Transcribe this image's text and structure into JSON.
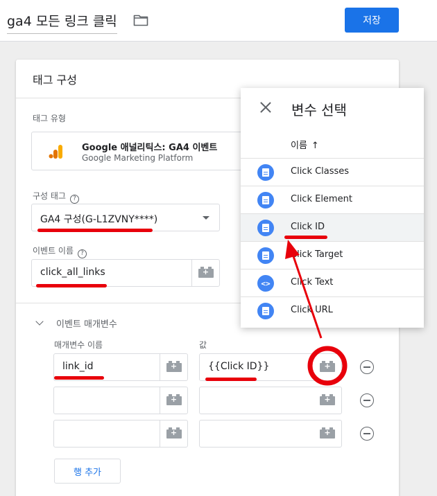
{
  "header": {
    "title": "ga4 모든 링크 클릭",
    "save_label": "저장"
  },
  "card": {
    "title": "태그 구성",
    "tag_type_label": "태그 유형",
    "tag_type_name": "Google 애널리틱스: GA4 이벤트",
    "tag_type_sub": "Google Marketing Platform",
    "config_tag_label": "구성 태그",
    "config_tag_value": "GA4 구성(G-L1ZVNY****)",
    "event_name_label": "이벤트 이름",
    "event_name_value": "click_all_links",
    "params_section_title": "이벤트 매개변수",
    "param_name_header": "매개변수 이름",
    "value_header": "값",
    "rows": [
      {
        "name": "link_id",
        "value": "{{Click ID}}"
      },
      {
        "name": "",
        "value": ""
      },
      {
        "name": "",
        "value": ""
      }
    ],
    "add_row_label": "행 추가"
  },
  "panel": {
    "title": "변수 선택",
    "column_header": "이름",
    "sort_arrow": "↑",
    "items": [
      {
        "label": "Click Classes",
        "icon": "document-icon"
      },
      {
        "label": "Click Element",
        "icon": "document-icon"
      },
      {
        "label": "Click ID",
        "icon": "document-icon"
      },
      {
        "label": "Click Target",
        "icon": "document-icon"
      },
      {
        "label": "Click Text",
        "icon": "code-icon"
      },
      {
        "label": "Click URL",
        "icon": "document-icon"
      }
    ],
    "selected_item": "Click ID"
  },
  "icons": {
    "plus_glyph": "+",
    "code_glyph": "<>",
    "help_glyph": "?"
  },
  "colors": {
    "accent": "#1a73e8",
    "annotation": "#e8000b",
    "variable_icon": "#4285f4"
  }
}
